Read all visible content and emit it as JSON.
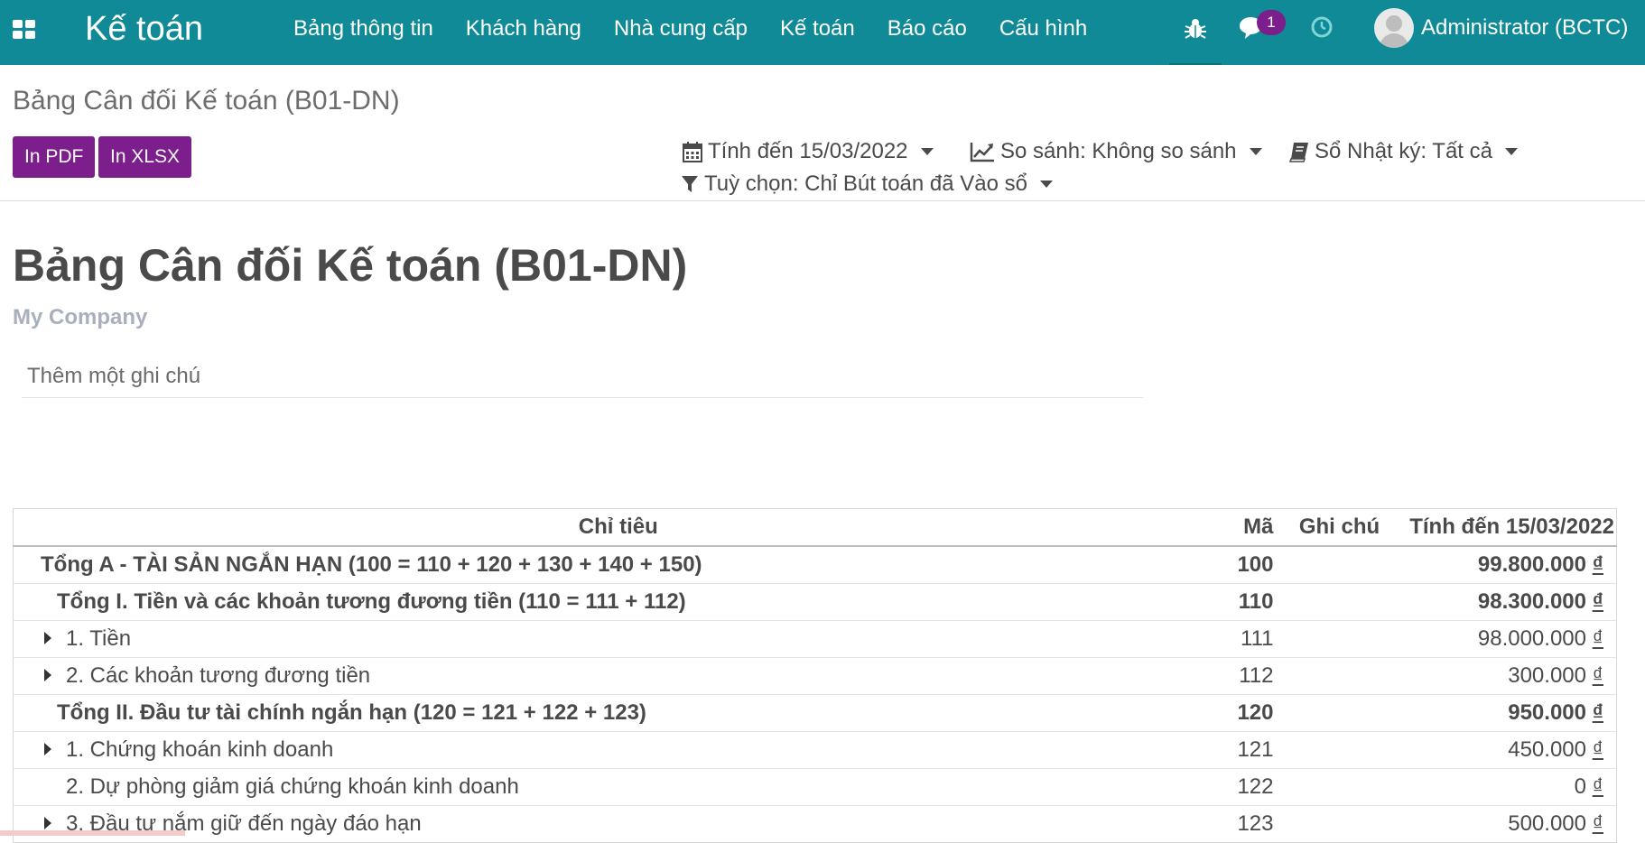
{
  "navbar": {
    "brand": "Kế toán",
    "menu": [
      "Bảng thông tin",
      "Khách hàng",
      "Nhà cung cấp",
      "Kế toán",
      "Báo cáo",
      "Cấu hình"
    ],
    "messages_count": "1",
    "user": "Administrator (BCTC)",
    "icons": [
      "apps-icon",
      "bug-icon",
      "chat-icon",
      "clock-icon"
    ],
    "color": "#0f8a96"
  },
  "control_panel": {
    "breadcrumb": "Bảng Cân đối Kế toán (B01-DN)",
    "buttons": {
      "pdf": "In PDF",
      "xlsx": "In XLSX"
    },
    "filters": {
      "date": "Tính đến 15/03/2022",
      "compare": "So sánh: Không so sánh",
      "journal": "Sổ Nhật ký: Tất cả",
      "options": "Tuỳ chọn: Chỉ Bút toán đã Vào sổ"
    },
    "button_color": "#7c1f8c"
  },
  "report": {
    "title": "Bảng Cân đối Kế toán (B01-DN)",
    "company": "My Company",
    "note_placeholder": "Thêm một ghi chú",
    "columns": {
      "name": "Chỉ tiêu",
      "code": "Mã",
      "note": "Ghi chú",
      "amount": "Tính đến 15/03/2022"
    },
    "rows": [
      {
        "name": "Tổng A - TÀI SẢN NGẮN HẠN (100 = 110 + 120 + 130 + 140 + 150)",
        "code": "100",
        "amount": "99.800.000",
        "currency": "₫",
        "level": 0,
        "total": true,
        "expandable": false
      },
      {
        "name": "Tổng I. Tiền và các khoản tương đương tiền (110 = 111 + 112)",
        "code": "110",
        "amount": "98.300.000",
        "currency": "₫",
        "level": 1,
        "total": true,
        "expandable": false
      },
      {
        "name": "1. Tiền",
        "code": "111",
        "amount": "98.000.000",
        "currency": "₫",
        "level": 2,
        "total": false,
        "expandable": true
      },
      {
        "name": "2. Các khoản tương đương tiền",
        "code": "112",
        "amount": "300.000",
        "currency": "₫",
        "level": 2,
        "total": false,
        "expandable": true
      },
      {
        "name": "Tổng II. Đầu tư tài chính ngắn hạn (120 = 121 + 122 + 123)",
        "code": "120",
        "amount": "950.000",
        "currency": "₫",
        "level": 1,
        "total": true,
        "expandable": false
      },
      {
        "name": "1. Chứng khoán kinh doanh",
        "code": "121",
        "amount": "450.000",
        "currency": "₫",
        "level": 2,
        "total": false,
        "expandable": true
      },
      {
        "name": "2. Dự phòng giảm giá chứng khoán kinh doanh",
        "code": "122",
        "amount": "0",
        "currency": "₫",
        "level": 2,
        "total": false,
        "expandable": false
      },
      {
        "name": "3. Đầu tư nắm giữ đến ngày đáo hạn",
        "code": "123",
        "amount": "500.000",
        "currency": "₫",
        "level": 2,
        "total": false,
        "expandable": true
      }
    ]
  }
}
